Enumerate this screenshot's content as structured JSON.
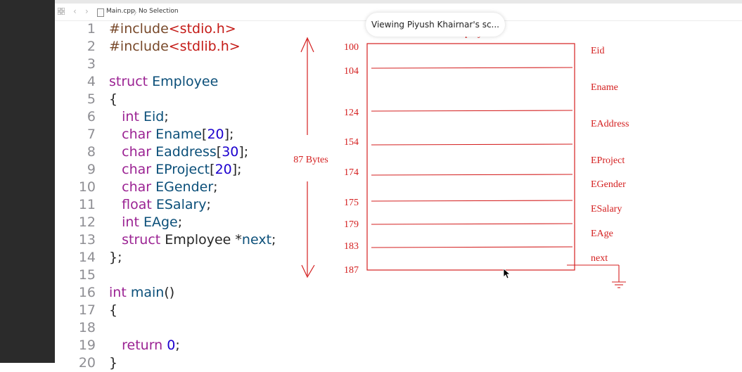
{
  "jumpbar": {
    "file": "Main.cpp",
    "separator": "〉",
    "selection": "No Selection"
  },
  "tooltip": "Viewing Piyush Khairnar's sc...",
  "code": [
    {
      "n": "1",
      "tokens": [
        {
          "t": "#include",
          "c": "pp"
        },
        {
          "t": "<stdio.h>",
          "c": "st"
        }
      ]
    },
    {
      "n": "2",
      "tokens": [
        {
          "t": "#include",
          "c": "pp"
        },
        {
          "t": "<stdlib.h>",
          "c": "st"
        }
      ]
    },
    {
      "n": "3",
      "tokens": []
    },
    {
      "n": "4",
      "tokens": [
        {
          "t": "struct",
          "c": "kw"
        },
        {
          "t": " ",
          "c": "pl"
        },
        {
          "t": "Employee",
          "c": "ty"
        }
      ]
    },
    {
      "n": "5",
      "tokens": [
        {
          "t": "{",
          "c": "pl"
        }
      ]
    },
    {
      "n": "6",
      "tokens": [
        {
          "t": "   ",
          "c": "pl"
        },
        {
          "t": "int",
          "c": "kw"
        },
        {
          "t": " ",
          "c": "pl"
        },
        {
          "t": "Eid",
          "c": "ty"
        },
        {
          "t": ";",
          "c": "pl"
        }
      ]
    },
    {
      "n": "7",
      "tokens": [
        {
          "t": "   ",
          "c": "pl"
        },
        {
          "t": "char",
          "c": "kw"
        },
        {
          "t": " ",
          "c": "pl"
        },
        {
          "t": "Ename",
          "c": "ty"
        },
        {
          "t": "[",
          "c": "pl"
        },
        {
          "t": "20",
          "c": "num"
        },
        {
          "t": "];",
          "c": "pl"
        }
      ]
    },
    {
      "n": "8",
      "tokens": [
        {
          "t": "   ",
          "c": "pl"
        },
        {
          "t": "char",
          "c": "kw"
        },
        {
          "t": " ",
          "c": "pl"
        },
        {
          "t": "Eaddress",
          "c": "ty"
        },
        {
          "t": "[",
          "c": "pl"
        },
        {
          "t": "30",
          "c": "num"
        },
        {
          "t": "];",
          "c": "pl"
        }
      ]
    },
    {
      "n": "9",
      "tokens": [
        {
          "t": "   ",
          "c": "pl"
        },
        {
          "t": "char",
          "c": "kw"
        },
        {
          "t": " ",
          "c": "pl"
        },
        {
          "t": "EProject",
          "c": "ty"
        },
        {
          "t": "[",
          "c": "pl"
        },
        {
          "t": "20",
          "c": "num"
        },
        {
          "t": "];",
          "c": "pl"
        }
      ]
    },
    {
      "n": "10",
      "tokens": [
        {
          "t": "   ",
          "c": "pl"
        },
        {
          "t": "char",
          "c": "kw"
        },
        {
          "t": " ",
          "c": "pl"
        },
        {
          "t": "EGender",
          "c": "ty"
        },
        {
          "t": ";",
          "c": "pl"
        }
      ]
    },
    {
      "n": "11",
      "tokens": [
        {
          "t": "   ",
          "c": "pl"
        },
        {
          "t": "float",
          "c": "kw"
        },
        {
          "t": " ",
          "c": "pl"
        },
        {
          "t": "ESalary",
          "c": "ty"
        },
        {
          "t": ";",
          "c": "pl"
        }
      ]
    },
    {
      "n": "12",
      "tokens": [
        {
          "t": "   ",
          "c": "pl"
        },
        {
          "t": "int",
          "c": "kw"
        },
        {
          "t": " ",
          "c": "pl"
        },
        {
          "t": "EAge",
          "c": "ty"
        },
        {
          "t": ";",
          "c": "pl"
        }
      ]
    },
    {
      "n": "13",
      "tokens": [
        {
          "t": "   ",
          "c": "pl"
        },
        {
          "t": "struct",
          "c": "kw"
        },
        {
          "t": " Employee *",
          "c": "pl"
        },
        {
          "t": "next",
          "c": "ty"
        },
        {
          "t": ";",
          "c": "pl"
        }
      ]
    },
    {
      "n": "14",
      "tokens": [
        {
          "t": "};",
          "c": "pl"
        }
      ]
    },
    {
      "n": "15",
      "tokens": []
    },
    {
      "n": "16",
      "tokens": [
        {
          "t": "int",
          "c": "kw"
        },
        {
          "t": " ",
          "c": "pl"
        },
        {
          "t": "main",
          "c": "ty"
        },
        {
          "t": "()",
          "c": "pl"
        }
      ]
    },
    {
      "n": "17",
      "tokens": [
        {
          "t": "{",
          "c": "pl"
        }
      ]
    },
    {
      "n": "18",
      "tokens": []
    },
    {
      "n": "19",
      "tokens": [
        {
          "t": "   ",
          "c": "pl"
        },
        {
          "t": "return",
          "c": "kw"
        },
        {
          "t": " ",
          "c": "pl"
        },
        {
          "t": "0",
          "c": "num"
        },
        {
          "t": ";",
          "c": "pl"
        }
      ]
    },
    {
      "n": "20",
      "tokens": [
        {
          "t": "}",
          "c": "pl"
        }
      ]
    }
  ],
  "diagram": {
    "color": "#d42020",
    "title": "Employee",
    "size_label": "87 Bytes",
    "offsets": [
      "100",
      "104",
      "124",
      "154",
      "174",
      "175",
      "179",
      "183",
      "187"
    ],
    "fields": [
      "Eid",
      "Ename",
      "EAddress",
      "EProject",
      "EGender",
      "ESalary",
      "EAge",
      "next"
    ]
  }
}
